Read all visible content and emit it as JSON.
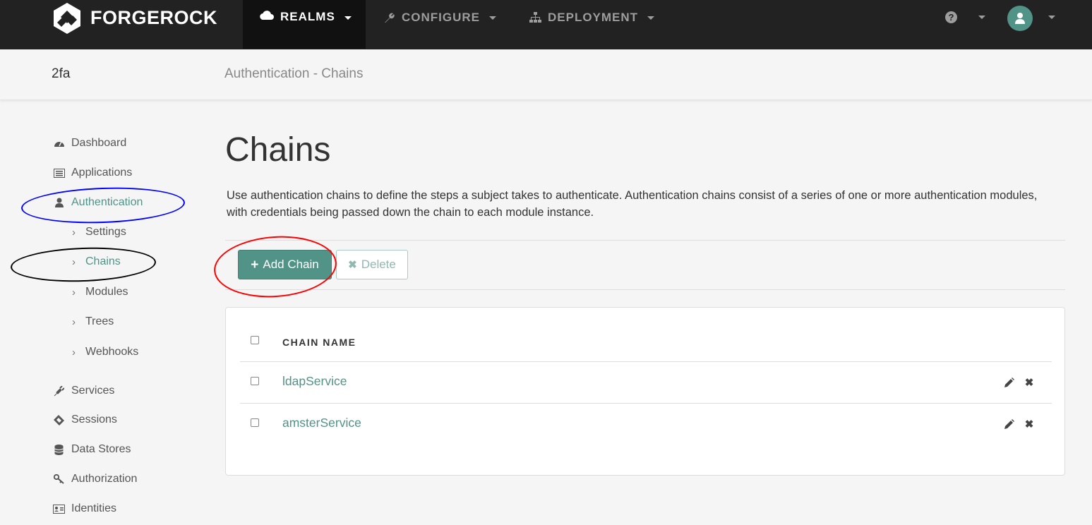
{
  "brand": {
    "name": "FORGEROCK"
  },
  "topnav": {
    "items": [
      {
        "label": "REALMS",
        "icon": "cloud-icon"
      },
      {
        "label": "CONFIGURE",
        "icon": "wrench-icon"
      },
      {
        "label": "DEPLOYMENT",
        "icon": "sitemap-icon"
      }
    ],
    "help_icon": "question-circle-icon",
    "user_icon": "user-avatar-icon"
  },
  "subheader": {
    "realm": "2fa",
    "breadcrumb": "Authentication - Chains"
  },
  "sidebar": {
    "items": [
      {
        "label": "Dashboard",
        "icon": "dashboard-icon"
      },
      {
        "label": "Applications",
        "icon": "list-alt-icon"
      },
      {
        "label": "Authentication",
        "icon": "user-icon"
      },
      {
        "label": "Services",
        "icon": "plug-icon"
      },
      {
        "label": "Sessions",
        "icon": "ticket-icon"
      },
      {
        "label": "Data Stores",
        "icon": "database-icon"
      },
      {
        "label": "Authorization",
        "icon": "key-icon"
      },
      {
        "label": "Identities",
        "icon": "id-card-icon"
      }
    ],
    "auth_subitems": [
      "Settings",
      "Chains",
      "Modules",
      "Trees",
      "Webhooks"
    ]
  },
  "main": {
    "title": "Chains",
    "description": "Use authentication chains to define the steps a subject takes to authenticate. Authentication chains consist of a series of one or more authentication modules, with credentials being passed down the chain to each module instance.",
    "add_button": "Add Chain",
    "delete_button": "Delete",
    "table": {
      "column_header": "CHAIN NAME",
      "rows": [
        {
          "name": "ldapService"
        },
        {
          "name": "amsterService"
        }
      ]
    }
  },
  "colors": {
    "accent": "#519387",
    "topbar": "#222222",
    "annotation_blue": "#0000ff",
    "annotation_black": "#000000",
    "annotation_red": "#ff0000"
  }
}
